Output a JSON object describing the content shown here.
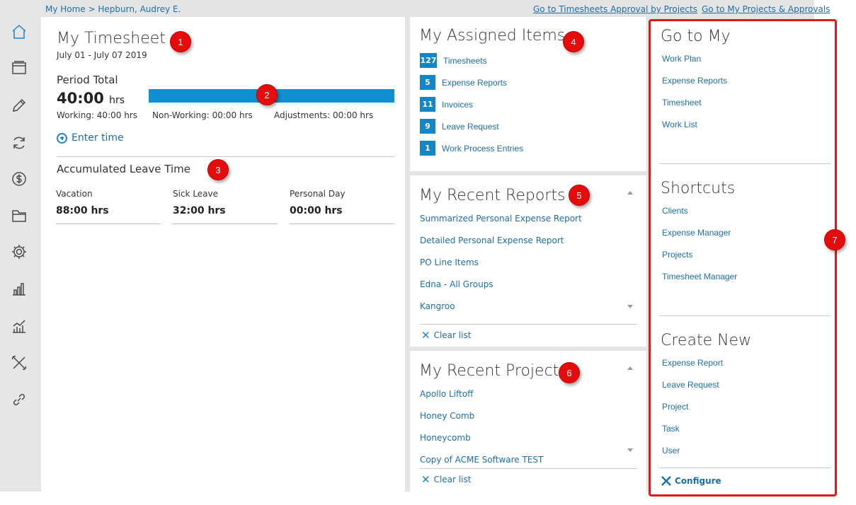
{
  "breadcrumb": "My Home > Hepburn, Audrey E.",
  "top_links": [
    "Go to Timesheets Approval by Projects",
    "Go to My Projects & Approvals"
  ],
  "sidebar_icons": [
    "home-icon",
    "window-icon",
    "pencil-icon",
    "sync-icon",
    "dollar-icon",
    "folder-icon",
    "gear-icon",
    "bar-chart-icon",
    "trend-chart-icon",
    "tools-icon",
    "link-icon"
  ],
  "timesheet": {
    "title": "My Timesheet",
    "date_range": "July 01 - July 07 2019",
    "period_label": "Period Total",
    "period_hours": "40:00",
    "period_unit": "hrs",
    "working": "Working: 40:00 hrs",
    "non_working": "Non-Working: 00:00 hrs",
    "adjustments": "Adjustments: 00:00 hrs",
    "enter_time": "Enter time",
    "leave_title": "Accumulated Leave Time",
    "leave": [
      {
        "name": "Vacation",
        "value": "88:00 hrs"
      },
      {
        "name": "Sick Leave",
        "value": "32:00 hrs"
      },
      {
        "name": "Personal Day",
        "value": "00:00 hrs"
      }
    ]
  },
  "assigned": {
    "title": "My Assigned Items",
    "items": [
      {
        "count": "127",
        "label": "Timesheets"
      },
      {
        "count": "5",
        "label": "Expense Reports"
      },
      {
        "count": "11",
        "label": "Invoices"
      },
      {
        "count": "9",
        "label": "Leave Request"
      },
      {
        "count": "1",
        "label": "Work Process Entries"
      }
    ]
  },
  "reports": {
    "title": "My Recent Reports",
    "items": [
      "Summarized Personal Expense Report",
      "Detailed Personal Expense Report",
      "PO Line Items",
      "Edna - All Groups",
      "Kangroo"
    ],
    "clear": "Clear list"
  },
  "projects": {
    "title": "My Recent Projects",
    "items": [
      "Apollo Liftoff",
      "Honey Comb",
      "Honeycomb",
      "Copy of ACME Software TEST"
    ],
    "clear": "Clear list"
  },
  "goto": {
    "title": "Go to My",
    "items": [
      "Work Plan",
      "Expense Reports",
      "Timesheet",
      "Work List"
    ]
  },
  "shortcuts": {
    "title": "Shortcuts",
    "items": [
      "Clients",
      "Expense Manager",
      "Projects",
      "Timesheet Manager"
    ]
  },
  "create_new": {
    "title": "Create New",
    "items": [
      "Expense Report",
      "Leave Request",
      "Project",
      "Task",
      "User"
    ]
  },
  "configure": "Configure",
  "markers": [
    "1",
    "2",
    "3",
    "4",
    "5",
    "6",
    "7"
  ],
  "colors": {
    "accent": "#1486c6",
    "marker": "#e40d0d",
    "frame": "#e01818"
  }
}
